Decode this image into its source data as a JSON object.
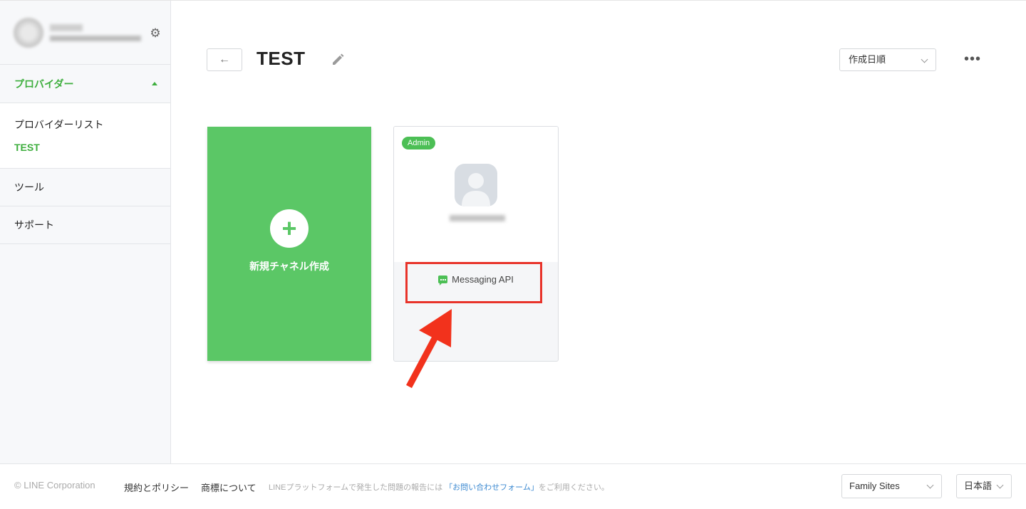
{
  "sidebar": {
    "section_label": "プロバイダー",
    "provider_list_label": "プロバイダーリスト",
    "active_provider": "TEST",
    "tools_label": "ツール",
    "support_label": "サポート"
  },
  "header": {
    "title": "TEST",
    "back_symbol": "←",
    "sort_value": "作成日順",
    "more_symbol": "•••"
  },
  "cards": {
    "new_channel": {
      "plus": "+",
      "label": "新規チャネル作成"
    },
    "channel": {
      "badge": "Admin",
      "type_label": "Messaging API"
    }
  },
  "footer": {
    "copyright": "© LINE Corporation",
    "link_terms": "規約とポリシー",
    "link_trademark": "商標について",
    "notice_prefix": "LINEプラットフォームで発生した問題の報告には",
    "notice_link": "「お問い合わせフォーム」",
    "notice_suffix": "をご利用ください。",
    "family_sites": "Family Sites",
    "language": "日本語"
  },
  "colors": {
    "accent_green": "#5bc766",
    "highlight_red": "#e8332a"
  }
}
